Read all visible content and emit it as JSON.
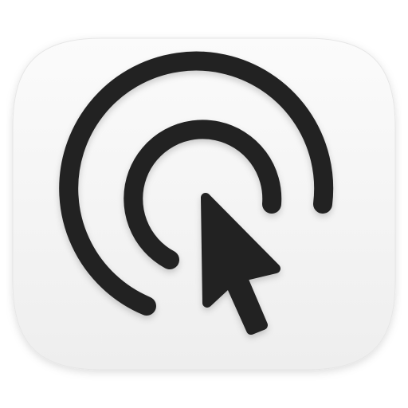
{
  "icon": {
    "name": "click-pointer-app-icon",
    "glyph": "cursor-click-icon"
  },
  "colors": {
    "tile_top": "#fbfbfb",
    "tile_bottom": "#eeeeee",
    "tile_edge": "#e6e6e6",
    "glyph": "#222222"
  }
}
